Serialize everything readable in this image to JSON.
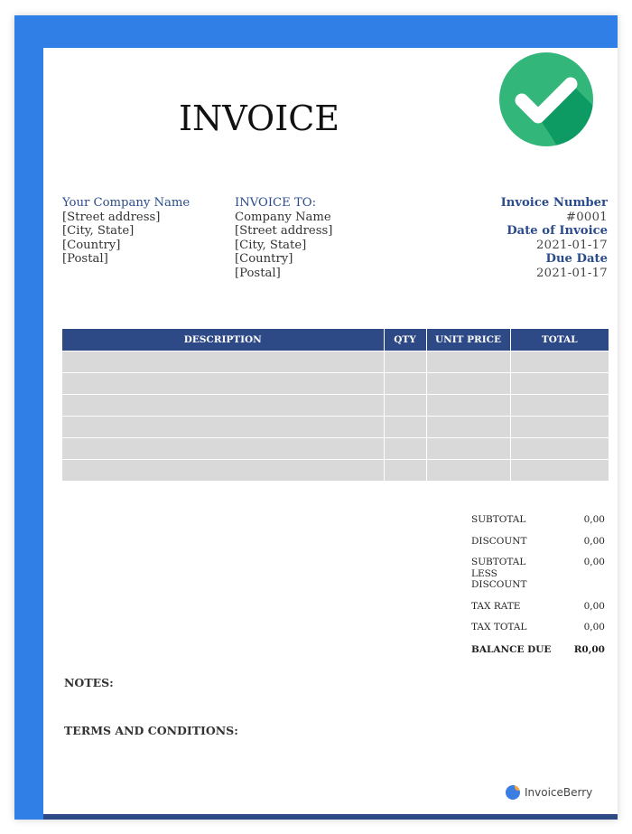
{
  "invoice": {
    "title": "INVOICE",
    "from": {
      "heading": "Your Company Name",
      "lines": [
        "[Street address]",
        "[City, State]",
        "[Country]",
        "[Postal]"
      ]
    },
    "to": {
      "heading": "INVOICE TO:",
      "lines": [
        "Company Name",
        "[Street address]",
        "[City, State]",
        "[Country]",
        "[Postal]"
      ]
    },
    "meta": {
      "number_label": "Invoice Number",
      "number_value": "#0001",
      "date_label": "Date of Invoice",
      "date_value": "2021-01-17",
      "due_label": "Due Date",
      "due_value": "2021-01-17"
    },
    "table": {
      "headers": [
        "DESCRIPTION",
        "QTY",
        "UNIT PRICE",
        "TOTAL"
      ],
      "empty_rows": 6
    },
    "totals": [
      {
        "label": "SUBTOTAL",
        "value": "0,00"
      },
      {
        "label": "DISCOUNT",
        "value": "0,00"
      },
      {
        "label": "SUBTOTAL LESS DISCOUNT",
        "value": "0,00"
      },
      {
        "label": "TAX RATE",
        "value": "0,00"
      },
      {
        "label": "TAX TOTAL",
        "value": "0,00"
      },
      {
        "label": "BALANCE DUE",
        "value": "R0,00"
      }
    ],
    "notes_label": "NOTES:",
    "terms_label": "TERMS AND CONDITIONS:",
    "brand": "InvoiceBerry"
  },
  "colors": {
    "frame": "#2f7fe6",
    "header_blue": "#2d4a86",
    "row_gray": "#d9d9d9",
    "check_green": "#33b679"
  },
  "icons": {
    "status": "check-circle-icon",
    "brand": "invoiceberry-logo-icon"
  }
}
